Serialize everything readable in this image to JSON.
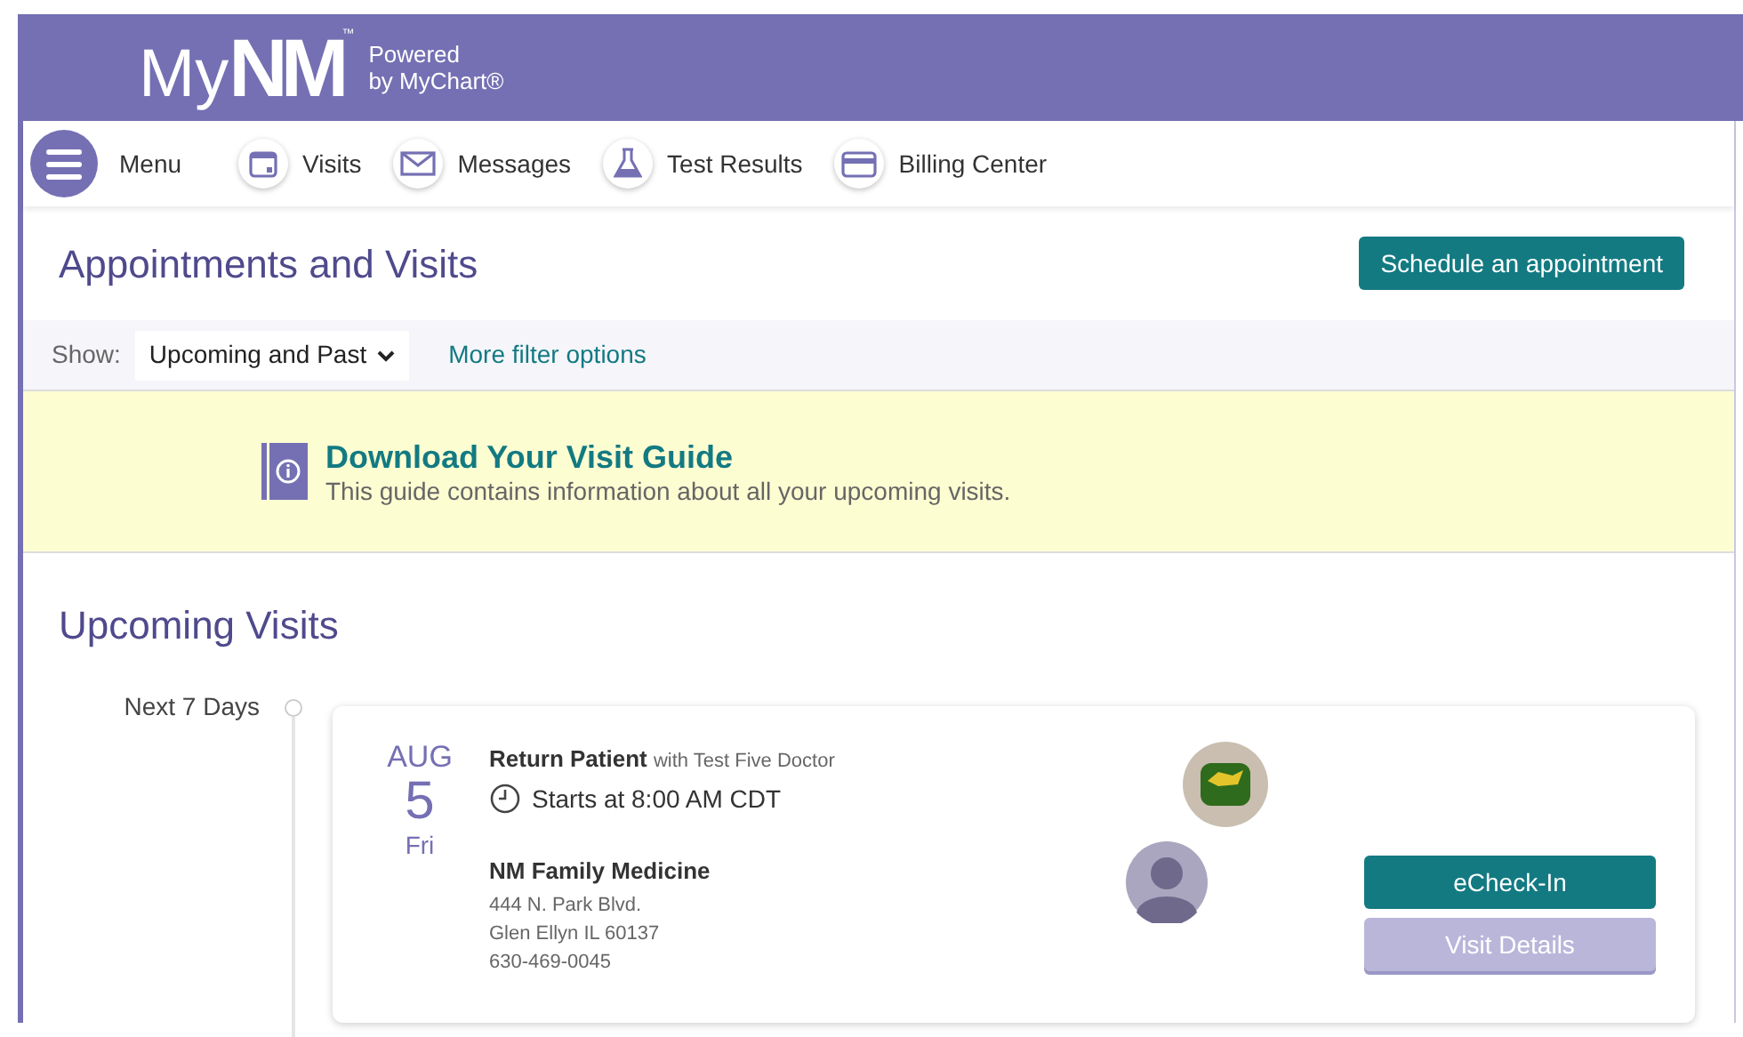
{
  "header": {
    "logo_prefix": "My",
    "logo_mark": "NM",
    "trademark": "™",
    "tagline_line_1": "Powered",
    "tagline_line_2": "by MyChart®"
  },
  "nav": [
    {
      "label": "Menu",
      "kind": "menu"
    },
    {
      "label": "Visits",
      "kind": "calendar"
    },
    {
      "label": "Messages",
      "kind": "envelope"
    },
    {
      "label": "Test Results",
      "kind": "flask"
    },
    {
      "label": "Billing Center",
      "kind": "card"
    }
  ],
  "page_title": "Appointments and Visits",
  "schedule_button": "Schedule an appointment",
  "filter": {
    "label": "Show:",
    "value": "Upcoming and Past",
    "link": "More filter options"
  },
  "banner": {
    "title": "Download Your Visit Guide",
    "text": "This guide contains information about all your upcoming visits."
  },
  "section_title": "Upcoming Visits",
  "timeline_label": "Next 7 Days",
  "visit": {
    "month": "AUG",
    "day": "5",
    "weekday": "Fri",
    "type": "Return Patient",
    "provider": "with Test Five Doctor",
    "time": "Starts at 8:00 AM CDT",
    "location": "NM Family Medicine",
    "address_line_1": "444 N. Park Blvd.",
    "address_line_2": "Glen Ellyn IL 60137",
    "phone": "630-469-0045",
    "actions": [
      {
        "label": "eCheck-In",
        "disabled": false
      },
      {
        "label": "Visit Details",
        "disabled": true
      }
    ]
  }
}
